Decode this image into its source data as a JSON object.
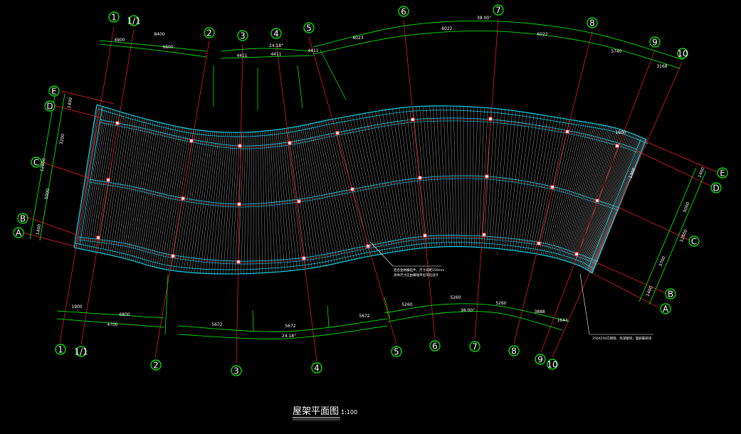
{
  "drawing": {
    "title": "屋架平面图",
    "scale": "1:100"
  },
  "colors": {
    "background": "#000000",
    "axis_line": "#ff2020",
    "dimension": "#00ff00",
    "roof_edge": "#00e5ff",
    "rafters": "#c8c8c8",
    "bubble_stroke": "#00ff00",
    "text": "#ffffff",
    "node": "#ff3030"
  },
  "axes": {
    "radial_top": [
      "1",
      "1/1",
      "2",
      "3",
      "4",
      "5",
      "6",
      "7",
      "8",
      "9",
      "10"
    ],
    "radial_bottom": [
      "1",
      "1/1",
      "2",
      "3",
      "4",
      "5",
      "6",
      "7",
      "8",
      "9",
      "10"
    ],
    "rows_left": [
      "E",
      "D",
      "C",
      "B",
      "A"
    ],
    "rows_right": [
      "E",
      "D",
      "C",
      "B",
      "A"
    ]
  },
  "dimensions": {
    "top": [
      "4900",
      "8400",
      "6800",
      "4411",
      "4411",
      "4411",
      "6023",
      "6022",
      "6022",
      "5740",
      "3168"
    ],
    "top_angles": [
      "24.18°",
      "38.00°"
    ],
    "bottom": [
      "1900",
      "6800",
      "4700",
      "5672",
      "5672",
      "5672",
      "5260",
      "5260",
      "5260",
      "3888",
      "1644"
    ],
    "bottom_angles": [
      "24.18°",
      "38.00°"
    ],
    "left": [
      "1400",
      "3200",
      "12800",
      "5000",
      "1400"
    ],
    "right": [
      "1400",
      "5000",
      "12800",
      "3700",
      "1400"
    ],
    "small_top_right": [
      "1900",
      "1300"
    ]
  },
  "notes": {
    "note1_line1": "铝合金格栅挂件，尺寸间距150mm",
    "note1_line2": "具体尺寸应由幕墙单位深化设计",
    "note2": "250X250方钢管，热浸镀锌，面刷氟碳漆"
  }
}
